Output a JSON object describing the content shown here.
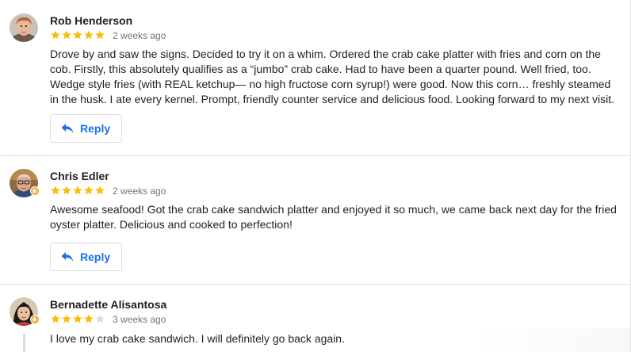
{
  "reviews": [
    {
      "author": "Rob Henderson",
      "rating": 5,
      "time": "2 weeks ago",
      "text": "Drove by and saw the signs. Decided to try it on a whim. Ordered the crab cake platter with fries and corn on the cob. Firstly, this absolutely qualifies as a “jumbo” crab cake. Had to have been a quarter pound. Well fried, too. Wedge style fries (with REAL ketchup— no high fructose corn syrup!) were good. Now this corn… freshly steamed in the husk. I ate every kernel. Prompt, friendly counter service and delicious food. Looking forward to my next visit.",
      "reply_label": "Reply"
    },
    {
      "author": "Chris Edler",
      "rating": 5,
      "time": "2 weeks ago",
      "text": "Awesome seafood! Got the crab cake sandwich platter and enjoyed it so much, we came back next day for the fried oyster platter. Delicious and cooked to perfection!",
      "reply_label": "Reply"
    },
    {
      "author": "Bernadette Alisantosa",
      "rating": 4,
      "time": "3 weeks ago",
      "text": "I love my crab cake sandwich. I will definitely go back again."
    }
  ],
  "colors": {
    "star_filled": "#fbbc04",
    "star_empty": "#dadce0",
    "reply_text": "#1a73e8",
    "badge": "#f7a534"
  },
  "icons": {
    "reply": "reply-arrow-icon",
    "star": "star-icon",
    "local_guide_badge": "local-guide-badge-icon"
  }
}
